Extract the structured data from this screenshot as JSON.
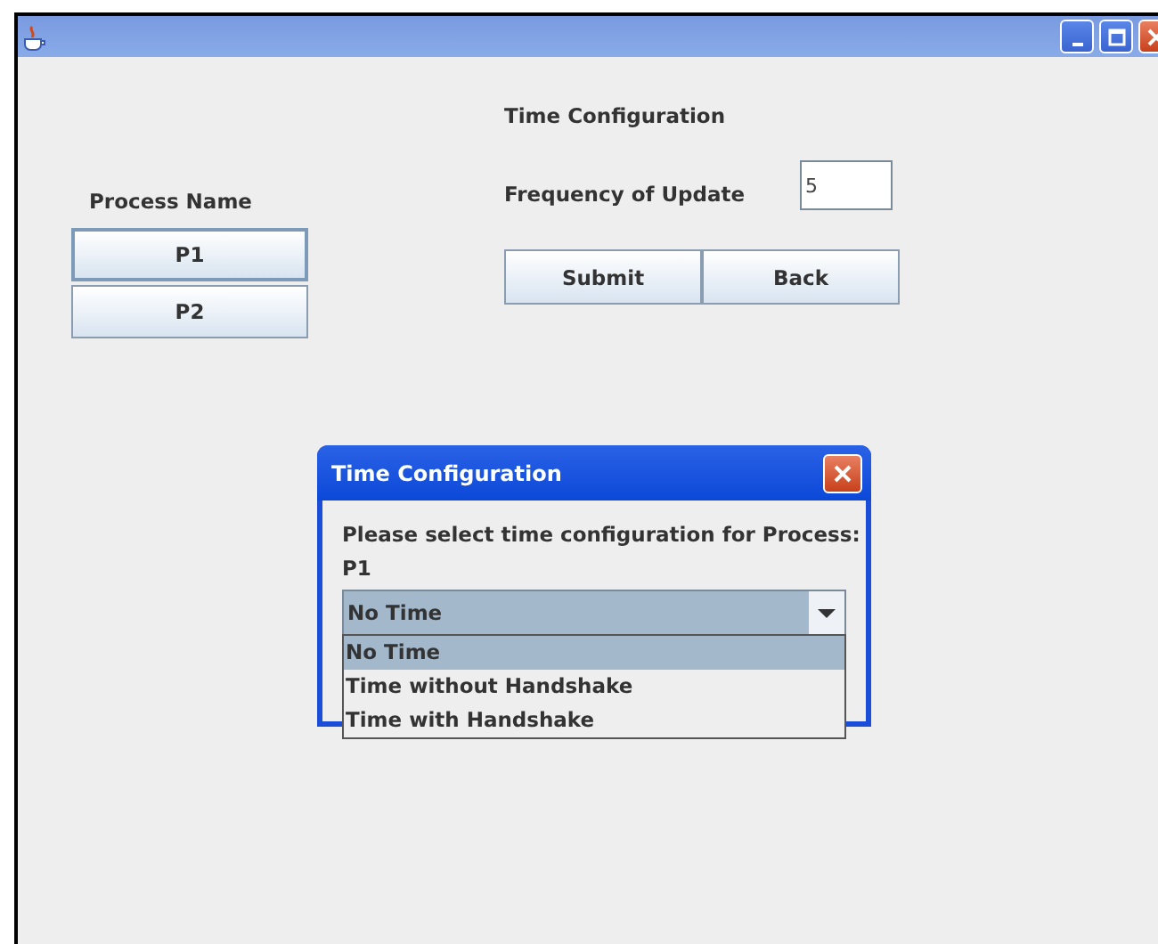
{
  "heading": "Time Configuration",
  "process_label": "Process Name",
  "processes": [
    {
      "label": "P1",
      "selected": true
    },
    {
      "label": "P2",
      "selected": false
    }
  ],
  "frequency": {
    "label": "Frequency of Update",
    "value": "5"
  },
  "buttons": [
    "Submit",
    "Back"
  ],
  "dialog": {
    "title": "Time Configuration",
    "message": "Please select time configuration for Process:",
    "process": "P1",
    "combo": {
      "value": "No Time",
      "expanded": true,
      "options": [
        {
          "label": "No Time",
          "selected": true
        },
        {
          "label": "Time without Handshake",
          "selected": false
        },
        {
          "label": "Time with Handshake",
          "selected": false
        }
      ]
    }
  }
}
